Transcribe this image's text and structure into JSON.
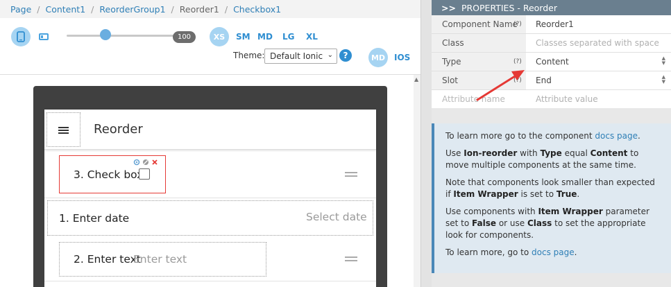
{
  "breadcrumb": {
    "items": [
      "Page",
      "Content1",
      "ReorderGroup1",
      "Reorder1",
      "Checkbox1"
    ],
    "separator": "/"
  },
  "toolbar": {
    "zoom_value": "100",
    "zoom_level": 0.35,
    "sizes": [
      "XS",
      "SM",
      "MD",
      "LG",
      "XL"
    ],
    "theme_label": "Theme:",
    "theme_value": "Default Ionic",
    "help_label": "?",
    "modes": [
      "MD",
      "IOS"
    ]
  },
  "preview": {
    "title": "Reorder",
    "items": [
      {
        "label": "3. Check box"
      },
      {
        "label": "1. Enter date",
        "placeholder": "Select date"
      },
      {
        "label": "2. Enter text",
        "placeholder": "Enter text"
      }
    ],
    "edit_icons": [
      "gear-icon",
      "hide-icon",
      "delete-icon"
    ]
  },
  "properties": {
    "header": "PROPERTIES - Reorder",
    "header_icon": ">>",
    "rows": [
      {
        "key": "Component Name",
        "hint": "(?)",
        "value": "Reorder1"
      },
      {
        "key": "Class",
        "hint": "",
        "value": "Classes separated with space",
        "placeholder": true
      },
      {
        "key": "Type",
        "hint": "(?)",
        "value": "Content",
        "select": true
      },
      {
        "key": "Slot",
        "hint": "(?)",
        "value": "End",
        "select": true
      },
      {
        "key": "Attribute name",
        "hint": "",
        "value": "Attribute value",
        "placeholder": true
      }
    ]
  },
  "info": {
    "p1_text": "To learn more go to the component ",
    "p1_link": "docs page",
    "p1_end": ".",
    "p2_a": "Use ",
    "p2_b": "Ion-reorder",
    "p2_c": " with ",
    "p2_d": "Type",
    "p2_e": " equal ",
    "p2_f": "Content",
    "p2_g": " to move multiple components at the same time.",
    "p3_a": "Note that components look smaller than expected if ",
    "p3_b": "Item Wrapper",
    "p3_c": " is set to ",
    "p3_d": "True",
    "p3_e": ".",
    "p4_a": "Use components with ",
    "p4_b": "Item Wrapper",
    "p4_c": " parameter set to ",
    "p4_d": "False",
    "p4_e": " or use ",
    "p4_f": "Class",
    "p4_g": " to set the appropriate look for components.",
    "p5_text": "To learn more, go to ",
    "p5_link": "docs page",
    "p5_end": "."
  },
  "colors": {
    "accent": "#2f8ed1",
    "selection": "#e53935",
    "header_bg": "#6a7f8f",
    "info_bg": "#dfe9f1"
  }
}
